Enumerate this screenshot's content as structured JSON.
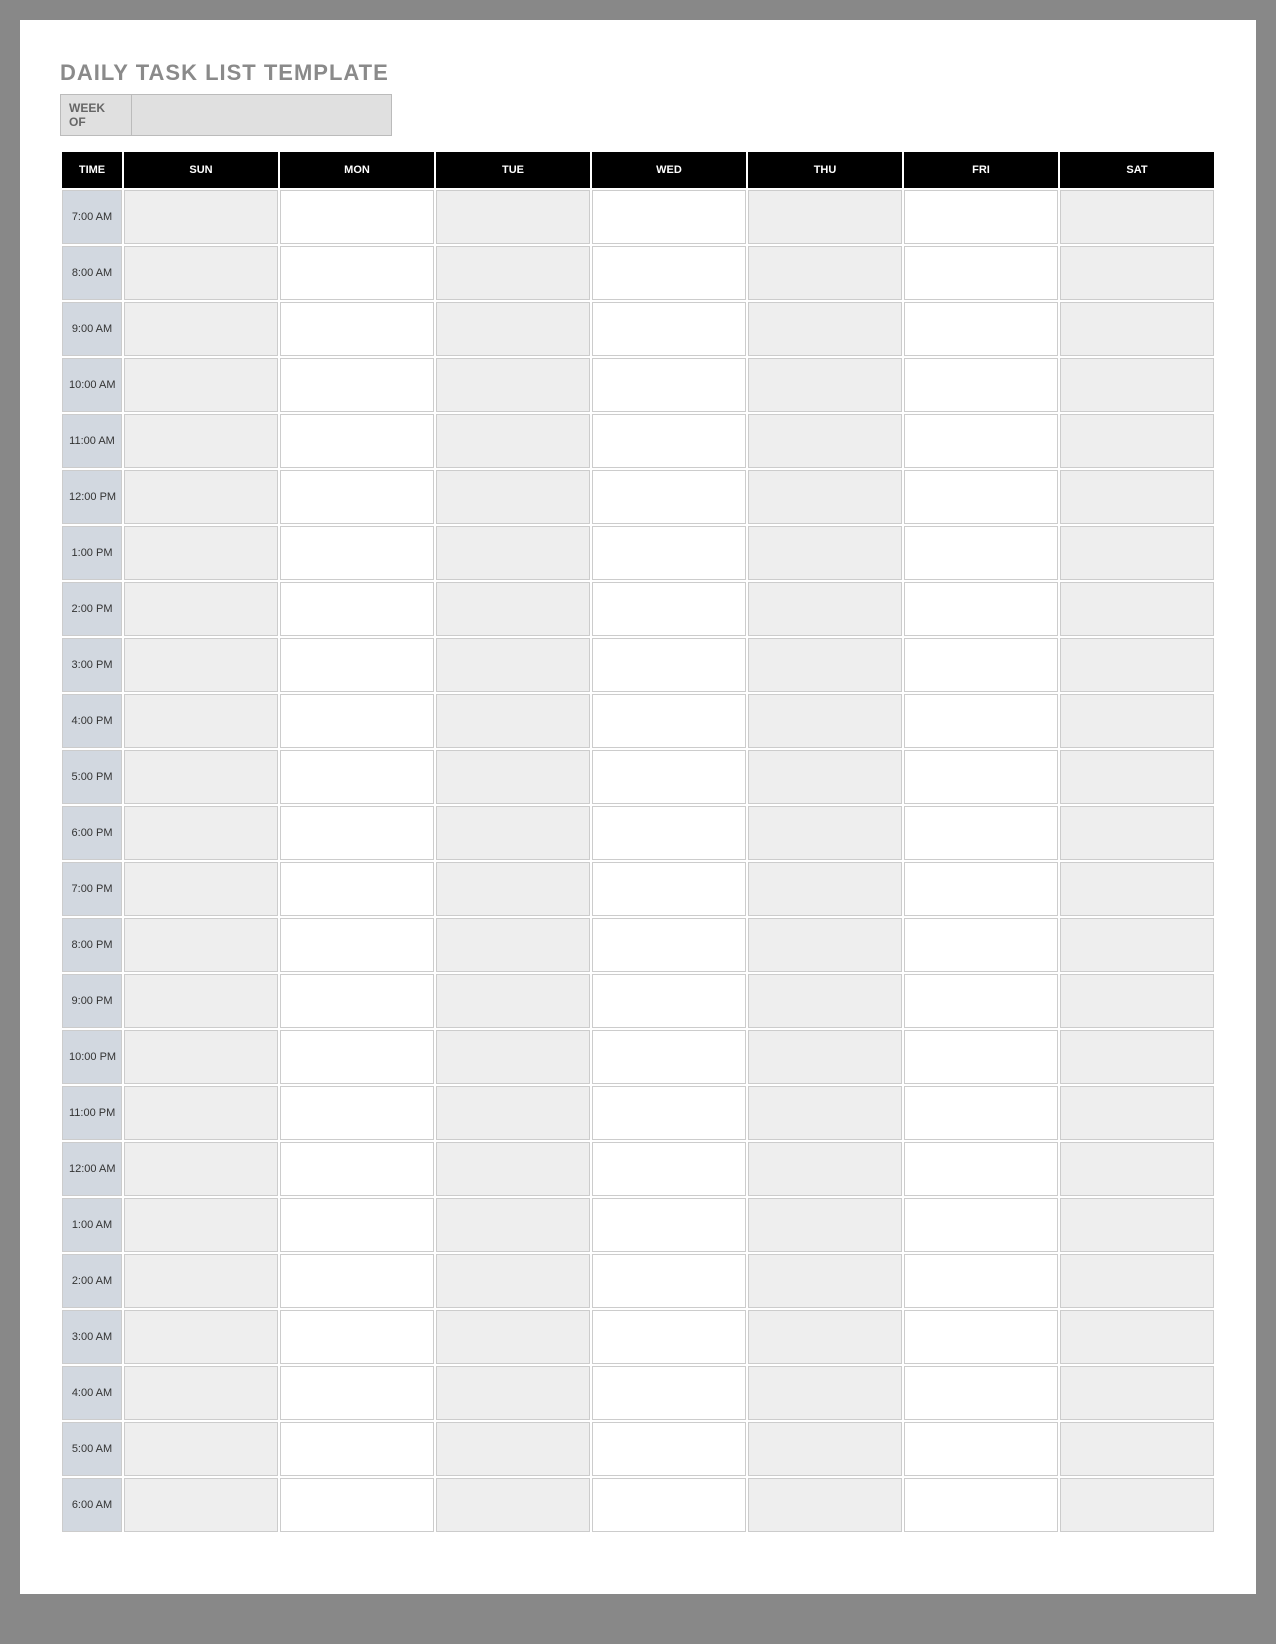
{
  "title": "DAILY TASK LIST TEMPLATE",
  "weekof_label": "WEEK OF",
  "weekof_value": "",
  "columns": [
    "TIME",
    "SUN",
    "MON",
    "TUE",
    "WED",
    "THU",
    "FRI",
    "SAT"
  ],
  "times": [
    "7:00 AM",
    "8:00 AM",
    "9:00 AM",
    "10:00 AM",
    "11:00 AM",
    "12:00 PM",
    "1:00 PM",
    "2:00 PM",
    "3:00 PM",
    "4:00 PM",
    "5:00 PM",
    "6:00 PM",
    "7:00 PM",
    "8:00 PM",
    "9:00 PM",
    "10:00 PM",
    "11:00 PM",
    "12:00 AM",
    "1:00 AM",
    "2:00 AM",
    "3:00 AM",
    "4:00 AM",
    "5:00 AM",
    "6:00 AM"
  ],
  "shaded_day_indices": [
    0,
    2,
    4,
    6
  ]
}
